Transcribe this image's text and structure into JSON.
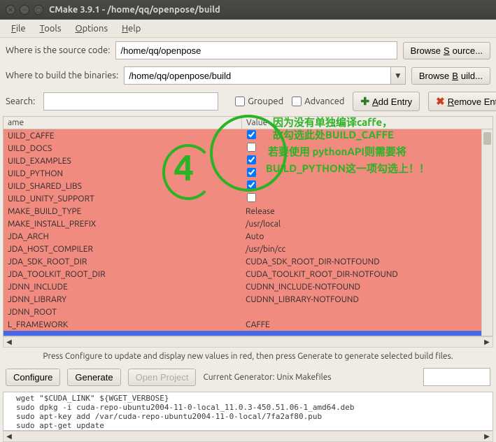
{
  "window": {
    "title": "CMake 3.9.1 - /home/qq/openpose/build"
  },
  "menubar": {
    "file": "File",
    "tools": "Tools",
    "options": "Options",
    "help": "Help"
  },
  "source": {
    "label": "Where is the source code:",
    "value": "/home/qq/openpose",
    "browse": "Browse Source..."
  },
  "build": {
    "label": "Where to build the binaries:",
    "value": "/home/qq/openpose/build",
    "browse": "Browse Build..."
  },
  "searchbar": {
    "label": "Search:",
    "value": "",
    "grouped": "Grouped",
    "advanced": "Advanced",
    "add": "Add Entry",
    "remove": "Remove Entry"
  },
  "table": {
    "head_name": "ame",
    "head_value": "Value",
    "rows": [
      {
        "name": "UILD_CAFFE",
        "type": "check",
        "checked": true
      },
      {
        "name": "UILD_DOCS",
        "type": "check",
        "checked": false
      },
      {
        "name": "UILD_EXAMPLES",
        "type": "check",
        "checked": true
      },
      {
        "name": "UILD_PYTHON",
        "type": "check",
        "checked": true
      },
      {
        "name": "UILD_SHARED_LIBS",
        "type": "check",
        "checked": true
      },
      {
        "name": "UILD_UNITY_SUPPORT",
        "type": "check",
        "checked": false
      },
      {
        "name": "MAKE_BUILD_TYPE",
        "type": "text",
        "value": "Release"
      },
      {
        "name": "MAKE_INSTALL_PREFIX",
        "type": "text",
        "value": "/usr/local"
      },
      {
        "name": "JDA_ARCH",
        "type": "text",
        "value": "Auto"
      },
      {
        "name": "JDA_HOST_COMPILER",
        "type": "text",
        "value": "/usr/bin/cc"
      },
      {
        "name": "JDA_SDK_ROOT_DIR",
        "type": "text",
        "value": "CUDA_SDK_ROOT_DIR-NOTFOUND"
      },
      {
        "name": "JDA_TOOLKIT_ROOT_DIR",
        "type": "text",
        "value": "CUDA_TOOLKIT_ROOT_DIR-NOTFOUND"
      },
      {
        "name": "JDNN_INCLUDE",
        "type": "text",
        "value": "CUDNN_INCLUDE-NOTFOUND"
      },
      {
        "name": "JDNN_LIBRARY",
        "type": "text",
        "value": "CUDNN_LIBRARY-NOTFOUND"
      },
      {
        "name": "JDNN_ROOT",
        "type": "text",
        "value": ""
      },
      {
        "name": "L_FRAMEWORK",
        "type": "text",
        "value": "CAFFE"
      }
    ],
    "selected_name": "..."
  },
  "annotations": {
    "l1": "因为没有单独编译caffe，",
    "l2": "故勾选此处BUILD_CAFFE",
    "l3": "若要使用 pythonAPI则需要将",
    "l4": "BUILD_PYTHON这一项勾选上！！"
  },
  "hint": "Press Configure to update and display new values in red, then press Generate to generate selected build files.",
  "buttons": {
    "configure": "Configure",
    "generate": "Generate",
    "open": "Open Project",
    "genlabel": "Current Generator: Unix Makefiles"
  },
  "log": {
    "l1": "wget \"$CUDA_LINK\" ${WGET_VERBOSE}",
    "l2": "sudo dpkg -i cuda-repo-ubuntu2004-11-0-local_11.0.3-450.51.06-1_amd64.deb",
    "l3": "sudo apt-key add /var/cuda-repo-ubuntu2004-11-0-local/7fa2af80.pub",
    "l4": "sudo apt-get update"
  }
}
